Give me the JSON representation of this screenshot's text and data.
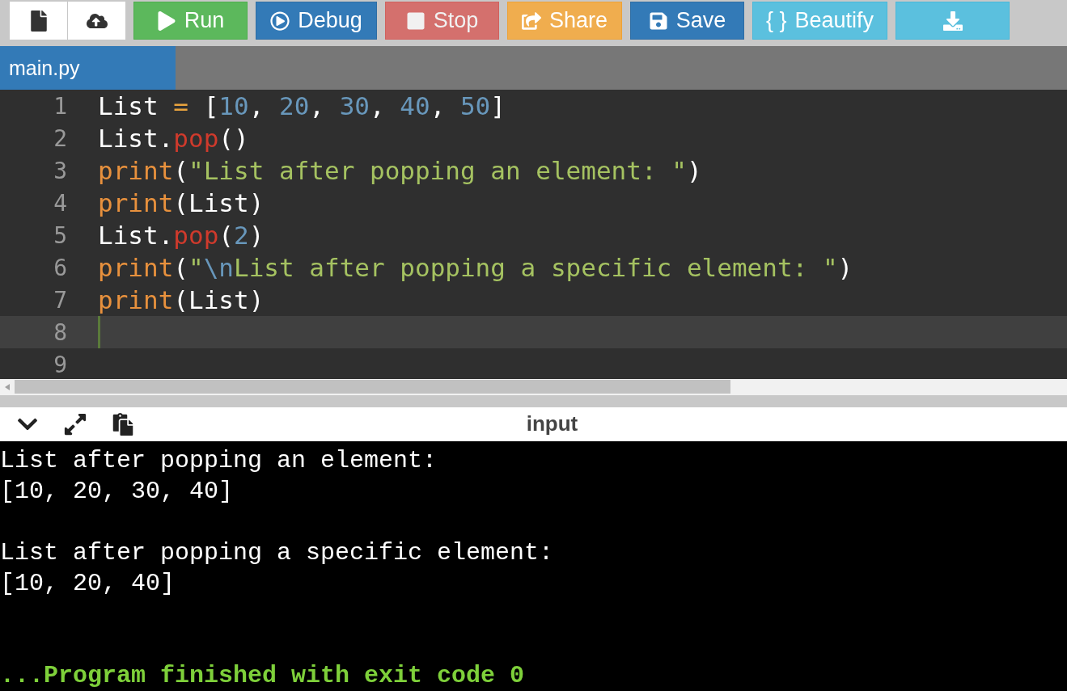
{
  "toolbar": [
    {
      "kind": "newfile",
      "disabled": false
    },
    {
      "kind": "upload",
      "disabled": false
    },
    {
      "kind": "run",
      "label": "Run",
      "disabled": false
    },
    {
      "kind": "debug",
      "label": "Debug",
      "disabled": false
    },
    {
      "kind": "stop",
      "label": "Stop",
      "disabled": true
    },
    {
      "kind": "share",
      "label": "Share",
      "disabled": false
    },
    {
      "kind": "save",
      "label": "Save",
      "disabled": false
    },
    {
      "kind": "beautify",
      "label": "Beautify",
      "icon_text": "{ }",
      "disabled": false
    },
    {
      "kind": "download",
      "disabled": false
    }
  ],
  "tabs": [
    {
      "label": "main.py",
      "selected": true
    }
  ],
  "editor": {
    "lines": [
      {
        "number": "1",
        "active": false,
        "tokens": [
          {
            "kind": "plain",
            "text": "List "
          },
          {
            "kind": "op",
            "text": "="
          },
          {
            "kind": "plain",
            "text": " ["
          },
          {
            "kind": "num",
            "text": "10"
          },
          {
            "kind": "plain",
            "text": ", "
          },
          {
            "kind": "num",
            "text": "20"
          },
          {
            "kind": "plain",
            "text": ", "
          },
          {
            "kind": "num",
            "text": "30"
          },
          {
            "kind": "plain",
            "text": ", "
          },
          {
            "kind": "num",
            "text": "40"
          },
          {
            "kind": "plain",
            "text": ", "
          },
          {
            "kind": "num",
            "text": "50"
          },
          {
            "kind": "plain",
            "text": "]"
          }
        ]
      },
      {
        "number": "2",
        "active": false,
        "tokens": [
          {
            "kind": "plain",
            "text": "List."
          },
          {
            "kind": "method",
            "text": "pop"
          },
          {
            "kind": "plain",
            "text": "()"
          }
        ]
      },
      {
        "number": "3",
        "active": false,
        "tokens": [
          {
            "kind": "builtin",
            "text": "print"
          },
          {
            "kind": "plain",
            "text": "("
          },
          {
            "kind": "str",
            "text": "\"List after popping an element: \""
          },
          {
            "kind": "plain",
            "text": ")"
          }
        ]
      },
      {
        "number": "4",
        "active": false,
        "tokens": [
          {
            "kind": "builtin",
            "text": "print"
          },
          {
            "kind": "plain",
            "text": "(List)"
          }
        ]
      },
      {
        "number": "5",
        "active": false,
        "tokens": [
          {
            "kind": "plain",
            "text": "List."
          },
          {
            "kind": "method",
            "text": "pop"
          },
          {
            "kind": "plain",
            "text": "("
          },
          {
            "kind": "num",
            "text": "2"
          },
          {
            "kind": "plain",
            "text": ")"
          }
        ]
      },
      {
        "number": "6",
        "active": false,
        "tokens": [
          {
            "kind": "builtin",
            "text": "print"
          },
          {
            "kind": "plain",
            "text": "("
          },
          {
            "kind": "str",
            "text": "\""
          },
          {
            "kind": "esc",
            "text": "\\n"
          },
          {
            "kind": "str",
            "text": "List after popping a specific element: \""
          },
          {
            "kind": "plain",
            "text": ")"
          }
        ]
      },
      {
        "number": "7",
        "active": false,
        "tokens": [
          {
            "kind": "builtin",
            "text": "print"
          },
          {
            "kind": "plain",
            "text": "(List)"
          }
        ]
      },
      {
        "number": "8",
        "active": true
      },
      {
        "number": "9",
        "active": false
      }
    ]
  },
  "output_panel": {
    "title": "input"
  },
  "terminal": {
    "blocks": [
      [
        "List after popping an element:",
        "[10, 20, 30, 40]"
      ],
      [
        "List after popping a specific element:",
        "[10, 20, 40]"
      ]
    ],
    "exit_message": "...Program finished with exit code 0"
  }
}
